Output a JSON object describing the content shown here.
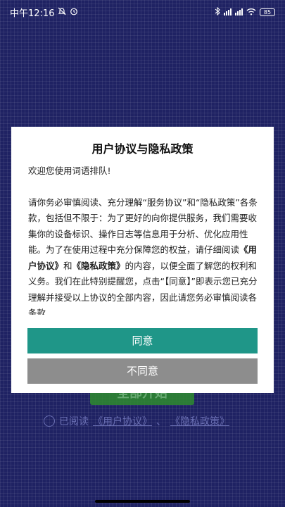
{
  "status_bar": {
    "time": "中午12:16",
    "battery": "85"
  },
  "background": {
    "start_button_label": "全部开始",
    "agree_prefix": "已阅读",
    "user_agreement_link": "《用户协议》",
    "separator": "、",
    "privacy_link": "《隐私政策》"
  },
  "dialog": {
    "title": "用户协议与隐私政策",
    "greeting": "欢迎您使用词语排队!",
    "paragraph_1": "请你务必审慎阅读、充分理解“服务协议”和“隐私政策”各条款，包括但不限于：为了更好的向你提供服务，我们需要收集你的设备标识、操作日志等信息用于分析、优化应用性能。为了在使用过程中充分保障您的权益，请仔细阅读",
    "link_user_agreement": "《用户协议》",
    "and": "和",
    "link_privacy": "《隐私政策》",
    "paragraph_2": "的内容，以便全面了解您的权利和义务。我们在此特别提醒您，点击“【同意】”即表示您已充分理解并接受以上协议的全部内容，因此请您务必审慎阅读各条款",
    "agree_button": "同意",
    "disagree_button": "不同意"
  },
  "colors": {
    "background": "#1f2263",
    "agree": "#1f9688",
    "disagree": "#8d8d8d"
  }
}
